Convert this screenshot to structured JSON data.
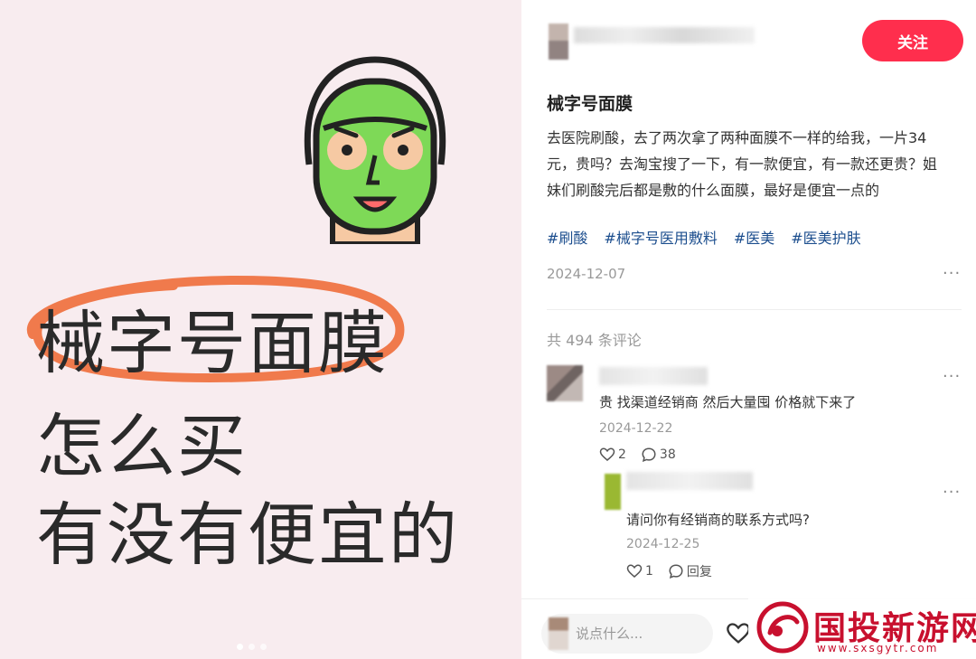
{
  "image": {
    "headline_line1": "械字号面膜",
    "headline_line2": "怎么买",
    "headline_line3": "有没有便宜的",
    "page_count": 3,
    "active_page": 1
  },
  "author": {
    "follow_label": "关注"
  },
  "note": {
    "title": "械字号面膜",
    "body": "去医院刷酸，去了两次拿了两种面膜不一样的给我，一片34元，贵吗？去淘宝搜了一下，有一款便宜，有一款还更贵？姐妹们刷酸完后都是敷的什么面膜，最好是便宜一点的",
    "tags": [
      "#刷酸",
      "#械字号医用敷料",
      "#医美",
      "#医美护肤"
    ],
    "date": "2024-12-07",
    "more": "···"
  },
  "comments": {
    "count_label": "共 494 条评论",
    "items": [
      {
        "text": "贵 找渠道经销商 然后大量囤 价格就下来了",
        "date": "2024-12-22",
        "likes": "2",
        "replies": "38",
        "more": "···"
      },
      {
        "text": "请问你有经销商的联系方式吗?",
        "date": "2024-12-25",
        "likes": "1",
        "reply_label": "回复",
        "more": "···"
      }
    ]
  },
  "bottom": {
    "input_placeholder": "说点什么..."
  },
  "watermark": {
    "title": "国投新游网",
    "url": "www.sxsgytr.com"
  },
  "colors": {
    "accent": "#ff2e4d",
    "tag": "#1c4e8e",
    "image_bg": "#f8ecef",
    "mask_green": "#7ed957",
    "circle_orange": "#f07a4c",
    "watermark_red": "#c8102e"
  }
}
